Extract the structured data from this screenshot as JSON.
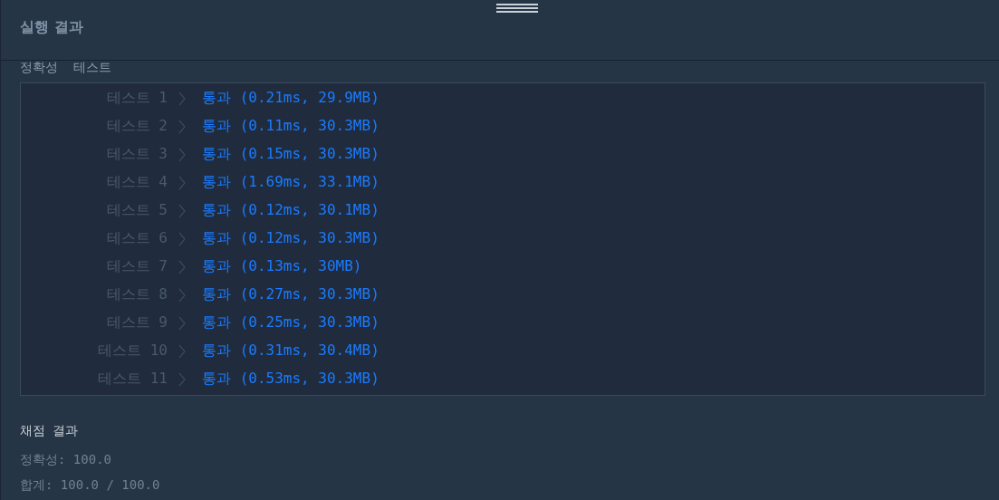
{
  "panel": {
    "title": "실행 결과"
  },
  "section_title": "정확성  테스트",
  "tests": [
    {
      "label": "테스트 1",
      "kind": "pass",
      "result": "통과 (0.21ms, 29.9MB)"
    },
    {
      "label": "테스트 2",
      "kind": "pass",
      "result": "통과 (0.11ms, 30.3MB)"
    },
    {
      "label": "테스트 3",
      "kind": "pass",
      "result": "통과 (0.15ms, 30.3MB)"
    },
    {
      "label": "테스트 4",
      "kind": "pass",
      "result": "통과 (1.69ms, 33.1MB)"
    },
    {
      "label": "테스트 5",
      "kind": "pass",
      "result": "통과 (0.12ms, 30.1MB)"
    },
    {
      "label": "테스트 6",
      "kind": "pass",
      "result": "통과 (0.12ms, 30.3MB)"
    },
    {
      "label": "테스트 7",
      "kind": "pass",
      "result": "통과 (0.13ms, 30MB)"
    },
    {
      "label": "테스트 8",
      "kind": "pass",
      "result": "통과 (0.27ms, 30.3MB)"
    },
    {
      "label": "테스트 9",
      "kind": "pass",
      "result": "통과 (0.25ms, 30.3MB)"
    },
    {
      "label": "테스트 10",
      "kind": "pass",
      "result": "통과 (0.31ms, 30.4MB)"
    },
    {
      "label": "테스트 11",
      "kind": "pass",
      "result": "통과 (0.53ms, 30.3MB)"
    }
  ],
  "grading": {
    "title": "채점 결과",
    "lines": [
      "정확성: 100.0",
      "합계: 100.0 / 100.0"
    ]
  }
}
